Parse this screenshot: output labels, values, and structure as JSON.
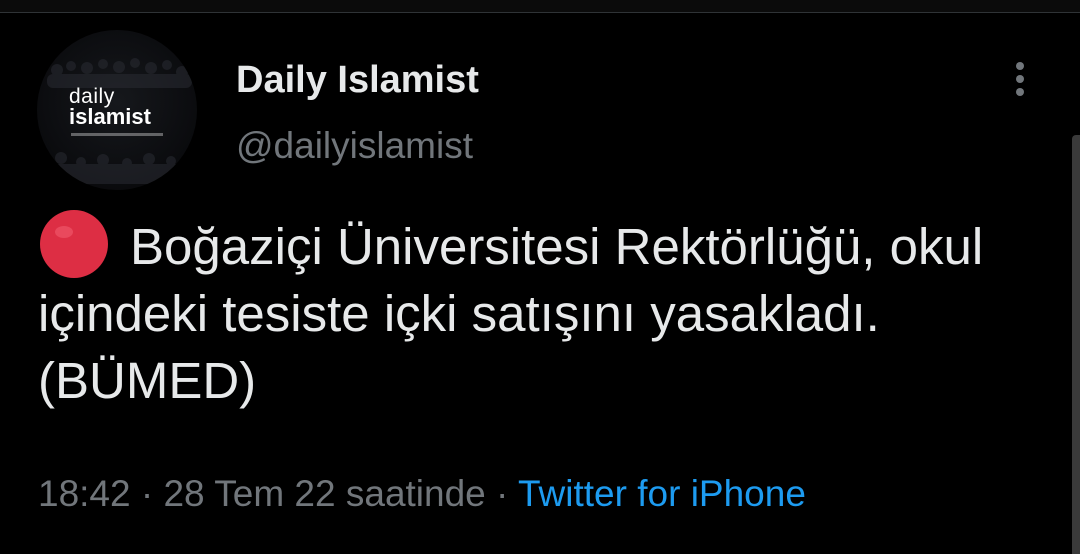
{
  "author": {
    "display_name": "Daily Islamist",
    "handle": "@dailyislamist",
    "avatar_logo_line1": "daily",
    "avatar_logo_line2": "islamist"
  },
  "tweet": {
    "emoji": "red-circle",
    "text": "Boğaziçi Üniversitesi Rektörlüğü, okul içindeki tesiste içki satışını yasakladı. (BÜMED)"
  },
  "meta": {
    "time": "18:42",
    "separator1": "·",
    "date": "28 Tem 22 saatinde",
    "separator2": "·",
    "source": "Twitter for iPhone"
  },
  "colors": {
    "background": "#000000",
    "text_primary": "#e7e9ea",
    "text_secondary": "#71767b",
    "link": "#1d9bf0",
    "emoji_red": "#dd2e44"
  },
  "icons": {
    "more": "more-vertical-icon",
    "emoji": "red-circle-emoji-icon"
  }
}
